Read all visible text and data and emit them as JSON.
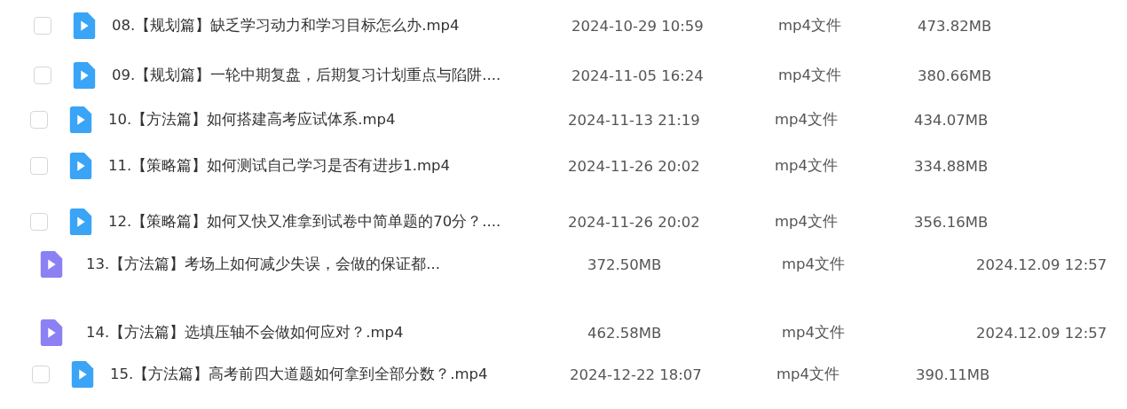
{
  "files": [
    {
      "kind": "cloud",
      "selected": false,
      "name": "08.【规划篇】缺乏学习动力和学习目标怎么办.mp4",
      "date": "2024-10-29 10:59",
      "type": "mp4文件",
      "size": "473.82MB"
    },
    {
      "kind": "cloud",
      "selected": false,
      "name": "09.【规划篇】一轮中期复盘，后期复习计划重点与陷阱....",
      "date": "2024-11-05 16:24",
      "type": "mp4文件",
      "size": "380.66MB"
    },
    {
      "kind": "cloud",
      "selected": false,
      "name": "10.【方法篇】如何搭建高考应试体系.mp4",
      "date": "2024-11-13 21:19",
      "type": "mp4文件",
      "size": "434.07MB"
    },
    {
      "kind": "cloud",
      "selected": false,
      "name": "11.【策略篇】如何测试自己学习是否有进步1.mp4",
      "date": "2024-11-26 20:02",
      "type": "mp4文件",
      "size": "334.88MB"
    },
    {
      "kind": "cloud",
      "selected": false,
      "name": "12.【策略篇】如何又快又准拿到试卷中简单题的70分？....",
      "date": "2024-11-26 20:02",
      "type": "mp4文件",
      "size": "356.16MB"
    },
    {
      "kind": "local",
      "name": "13.【方法篇】考场上如何减少失误，会做的保证都...",
      "size": "372.50MB",
      "type": "mp4文件",
      "date": "2024.12.09 12:57"
    },
    {
      "kind": "local",
      "name": "14.【方法篇】选填压轴不会做如何应对？.mp4",
      "size": "462.58MB",
      "type": "mp4文件",
      "date": "2024.12.09 12:57"
    },
    {
      "kind": "cloud",
      "selected": false,
      "name": "15.【方法篇】高考前四大道题如何拿到全部分数？.mp4",
      "date": "2024-12-22 18:07",
      "type": "mp4文件",
      "size": "390.11MB"
    }
  ]
}
